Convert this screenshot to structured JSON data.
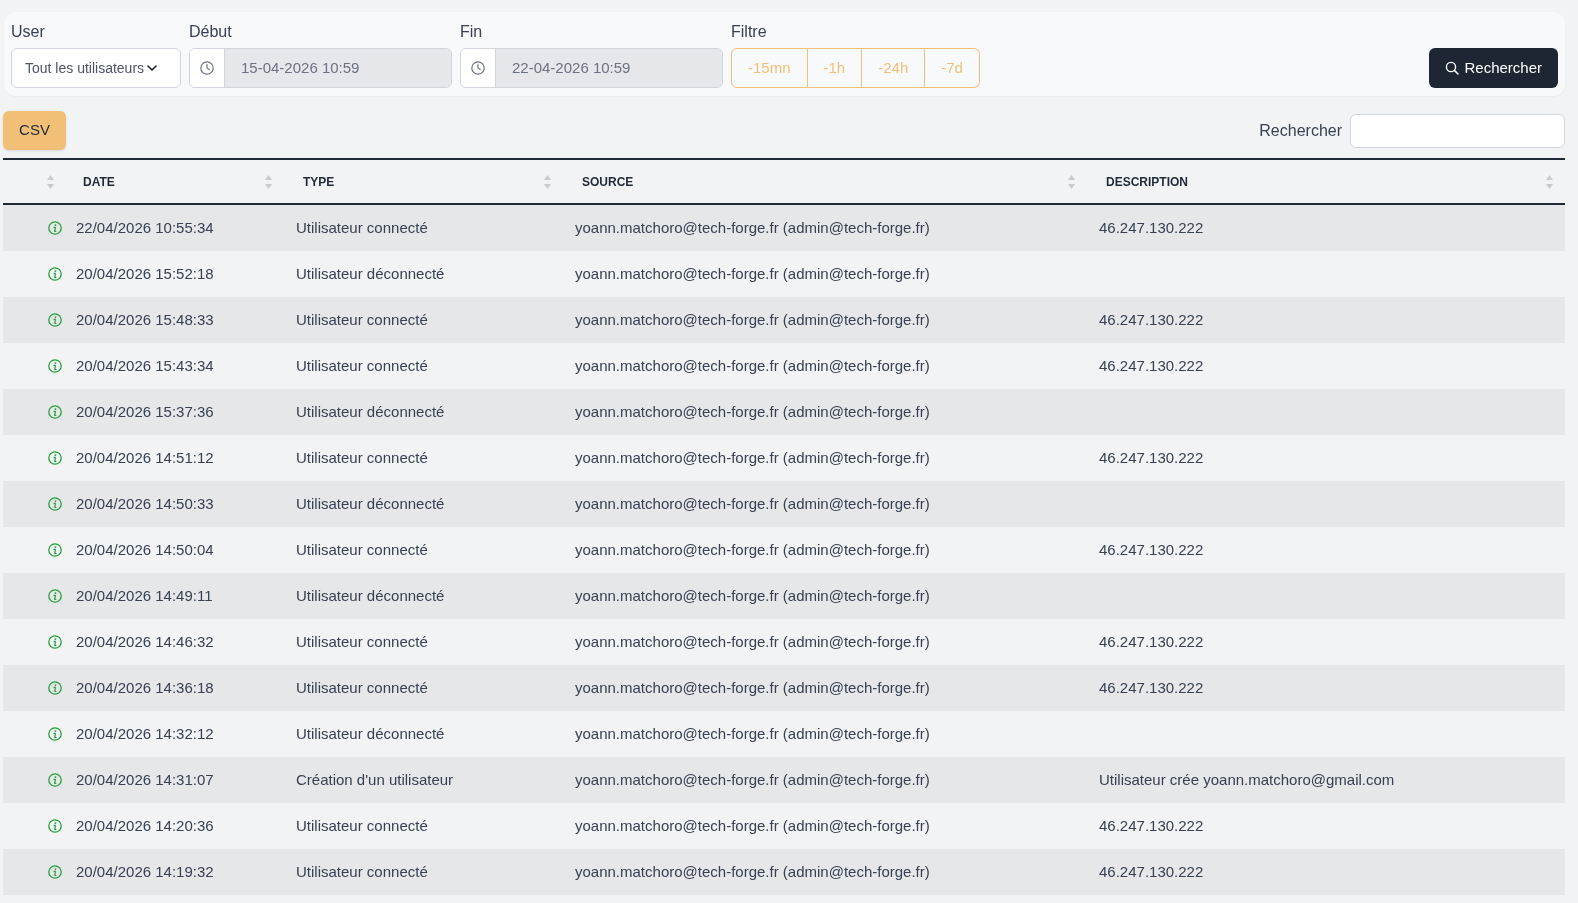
{
  "filters": {
    "user": {
      "label": "User",
      "value": "Tout les utilisateurs"
    },
    "start": {
      "label": "Début",
      "value": "15-04-2026 10:59"
    },
    "end": {
      "label": "Fin",
      "value": "22-04-2026 10:59"
    },
    "range": {
      "label": "Filtre",
      "options": [
        "-15mn",
        "-1h",
        "-24h",
        "-7d"
      ]
    },
    "search_button": "Rechercher"
  },
  "export_button": "CSV",
  "table_search": {
    "label": "Rechercher"
  },
  "table": {
    "columns": [
      "DATE",
      "TYPE",
      "SOURCE",
      "DESCRIPTION"
    ],
    "rows": [
      {
        "date": "22/04/2026 10:55:34",
        "type": "Utilisateur connecté",
        "source": "yoann.matchoro@tech-forge.fr (admin@tech-forge.fr)",
        "description": "46.247.130.222"
      },
      {
        "date": "20/04/2026 15:52:18",
        "type": "Utilisateur déconnecté",
        "source": "yoann.matchoro@tech-forge.fr (admin@tech-forge.fr)"
      },
      {
        "date": "20/04/2026 15:48:33",
        "type": "Utilisateur connecté",
        "source": "yoann.matchoro@tech-forge.fr (admin@tech-forge.fr)",
        "description": "46.247.130.222"
      },
      {
        "date": "20/04/2026 15:43:34",
        "type": "Utilisateur connecté",
        "source": "yoann.matchoro@tech-forge.fr (admin@tech-forge.fr)",
        "description": "46.247.130.222"
      },
      {
        "date": "20/04/2026 15:37:36",
        "type": "Utilisateur déconnecté",
        "source": "yoann.matchoro@tech-forge.fr (admin@tech-forge.fr)"
      },
      {
        "date": "20/04/2026 14:51:12",
        "type": "Utilisateur connecté",
        "source": "yoann.matchoro@tech-forge.fr (admin@tech-forge.fr)",
        "description": "46.247.130.222"
      },
      {
        "date": "20/04/2026 14:50:33",
        "type": "Utilisateur déconnecté",
        "source": "yoann.matchoro@tech-forge.fr (admin@tech-forge.fr)"
      },
      {
        "date": "20/04/2026 14:50:04",
        "type": "Utilisateur connecté",
        "source": "yoann.matchoro@tech-forge.fr (admin@tech-forge.fr)",
        "description": "46.247.130.222"
      },
      {
        "date": "20/04/2026 14:49:11",
        "type": "Utilisateur déconnecté",
        "source": "yoann.matchoro@tech-forge.fr (admin@tech-forge.fr)"
      },
      {
        "date": "20/04/2026 14:46:32",
        "type": "Utilisateur connecté",
        "source": "yoann.matchoro@tech-forge.fr (admin@tech-forge.fr)",
        "description": "46.247.130.222"
      },
      {
        "date": "20/04/2026 14:36:18",
        "type": "Utilisateur connecté",
        "source": "yoann.matchoro@tech-forge.fr (admin@tech-forge.fr)",
        "description": "46.247.130.222"
      },
      {
        "date": "20/04/2026 14:32:12",
        "type": "Utilisateur déconnecté",
        "source": "yoann.matchoro@tech-forge.fr (admin@tech-forge.fr)"
      },
      {
        "date": "20/04/2026 14:31:07",
        "type": "Création d'un utilisateur",
        "source": "yoann.matchoro@tech-forge.fr (admin@tech-forge.fr)",
        "description": "Utilisateur crée yoann.matchoro@gmail.com"
      },
      {
        "date": "20/04/2026 14:20:36",
        "type": "Utilisateur connecté",
        "source": "yoann.matchoro@tech-forge.fr (admin@tech-forge.fr)",
        "description": "46.247.130.222"
      },
      {
        "date": "20/04/2026 14:19:32",
        "type": "Utilisateur connecté",
        "source": "yoann.matchoro@tech-forge.fr (admin@tech-forge.fr)",
        "description": "46.247.130.222"
      }
    ]
  }
}
